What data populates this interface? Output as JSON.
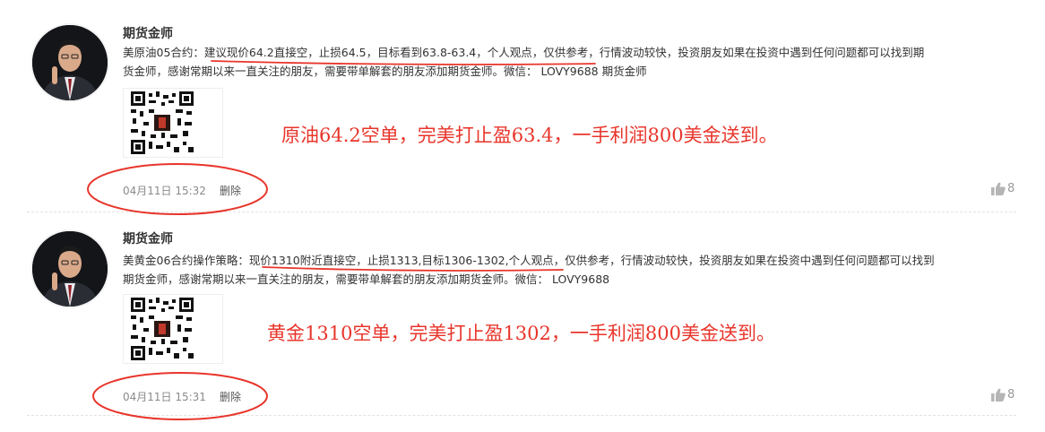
{
  "posts": [
    {
      "author": "期货金师",
      "content_prefix": "美原油05合约：",
      "content_underlined": "建议现价64.2直接空，止损64.5，目标看到63.8-63.4，个人观点，仅供参考",
      "content_rest_line1": "，行情波动较快，投资朋友如果在投资中遇到任何问题都可以找到期",
      "content_line2": "货金师，感谢常期以来一直关注的朋友，需要带单解套的朋友添加期货金师。微信： LOVY9688 期货金师",
      "highlight": "原油64.2空单，完美打止盈63.4，一手利润800美金送到。",
      "timestamp": "04月11日 15:32",
      "delete_label": "删除",
      "like_count": "8"
    },
    {
      "author": "期货金师",
      "content_prefix": "美黄金06合约操作策略：",
      "content_underlined": "现价1310附近直接空，止损1313,目标1306-1302,个人观点",
      "content_rest_line1": "，仅供参考，行情波动较快，投资朋友如果在投资中遇到任何问题都可以找到",
      "content_line2": "期货金师，感谢常期以来一直关注的朋友，需要带单解套的朋友添加期货金师。微信： LOVY9688",
      "highlight": "黄金1310空单，完美打止盈1302，一手利润800美金送到。",
      "timestamp": "04月11日 15:31",
      "delete_label": "删除",
      "like_count": "8"
    }
  ],
  "icons": {
    "like": "thumbs-up-icon",
    "qr": "qr-code"
  },
  "colors": {
    "annotation_red": "#e8352b",
    "meta_gray": "#8a8a8a"
  }
}
